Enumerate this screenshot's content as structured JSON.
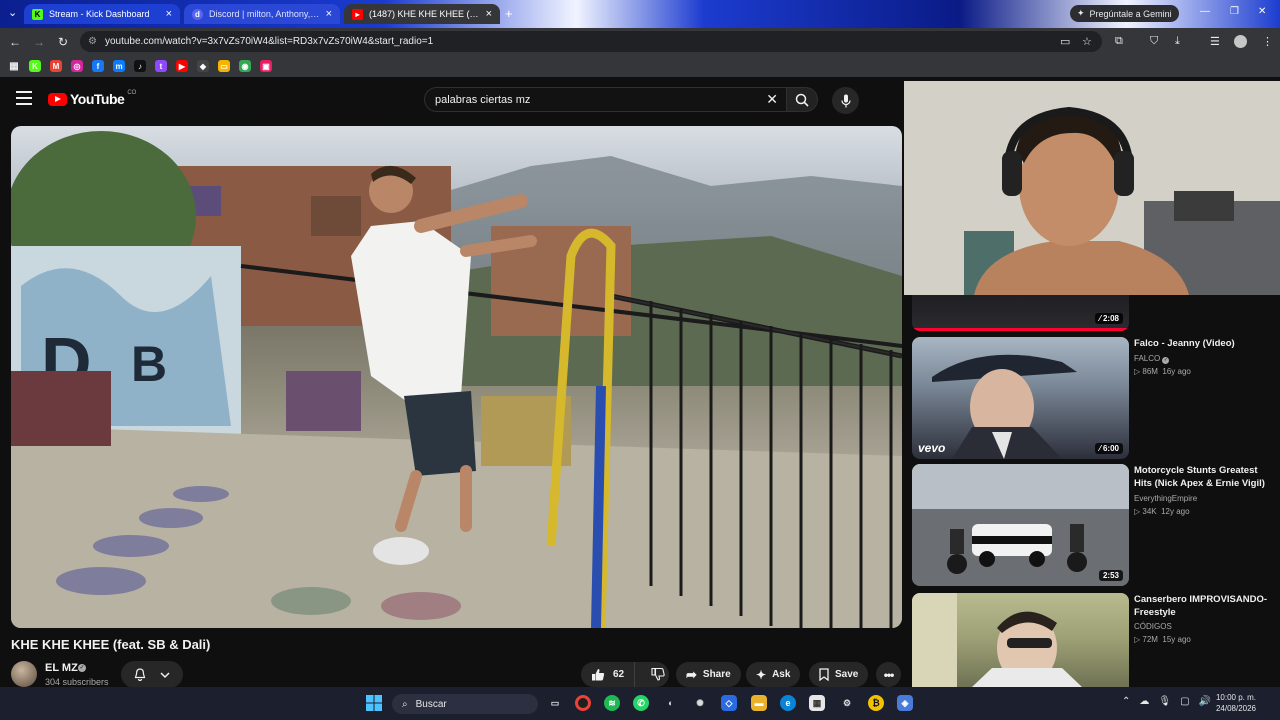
{
  "browser": {
    "tabs": [
      {
        "title": "Stream - Kick Dashboard",
        "favicon": "kick-icon",
        "color": "#53fc18"
      },
      {
        "title": "Discord | milton, Anthony, … fe",
        "favicon": "discord-icon",
        "color": "#5865f2"
      },
      {
        "title": "(1487) KHE KHE KHEE (feat. SB …",
        "favicon": "youtube-icon",
        "color": "#ff0000"
      }
    ],
    "new_tab": "+",
    "gemini_label": "Pregúntale a Gemini",
    "url": "youtube.com/watch?v=3x7vZs70iW4&list=RD3x7vZs70iW4&start_radio=1",
    "bookmarks": [
      {
        "icon": "kick-icon",
        "glyph": "K",
        "color": "#53fc18"
      },
      {
        "icon": "gmail-icon",
        "glyph": "M",
        "color": "#ea4335"
      },
      {
        "icon": "instagram-icon",
        "glyph": "◎",
        "color": "#d6249f"
      },
      {
        "icon": "facebook-icon",
        "glyph": "f",
        "color": "#1877f2"
      },
      {
        "icon": "messenger-icon",
        "glyph": "m",
        "color": "#0a7cff"
      },
      {
        "icon": "tiktok-icon",
        "glyph": "♪",
        "color": "#111111"
      },
      {
        "icon": "twitch-icon",
        "glyph": "t",
        "color": "#9146ff"
      },
      {
        "icon": "youtube-icon",
        "glyph": "▶",
        "color": "#ff0000"
      },
      {
        "icon": "deezer-icon",
        "glyph": "◆",
        "color": "#444444"
      },
      {
        "icon": "slides-icon",
        "glyph": "▭",
        "color": "#f4b400"
      },
      {
        "icon": "chrome-icon",
        "glyph": "◉",
        "color": "#34a853"
      },
      {
        "icon": "picture-icon",
        "glyph": "▣",
        "color": "#e91e63"
      }
    ]
  },
  "youtube": {
    "logo_text": "YouTube",
    "country_code": "CO",
    "search_query": "palabras ciertas mz",
    "video_title": "KHE KHE KHEE (feat. SB & Dali)",
    "channel_name": "EL MZ",
    "subscribers": "304 subscribers",
    "like_count": "62",
    "share_label": "Share",
    "ask_label": "Ask",
    "save_label": "Save",
    "partial_rec_duration": "2:08",
    "recommendations": [
      {
        "title": "Falco - Jeanny (Video)",
        "channel": "FALCO",
        "verified": true,
        "views": "86M",
        "age": "16y ago",
        "duration": "6:00",
        "badge": "vevo"
      },
      {
        "title": "Motorcycle Stunts Greatest Hits (Nick Apex & Ernie Vigil)",
        "channel": "EverythingEmpire",
        "verified": false,
        "views": "34K",
        "age": "12y ago",
        "duration": "2:53",
        "badge": ""
      },
      {
        "title": "Canserbero IMPROVISANDO- Freestyle",
        "channel": "CÓDIGOS",
        "verified": false,
        "views": "72M",
        "age": "15y ago",
        "duration": "",
        "badge": ""
      }
    ]
  },
  "taskbar": {
    "search_label": "Buscar",
    "time": "10:00 p. m.",
    "date": "24/08/2026"
  }
}
